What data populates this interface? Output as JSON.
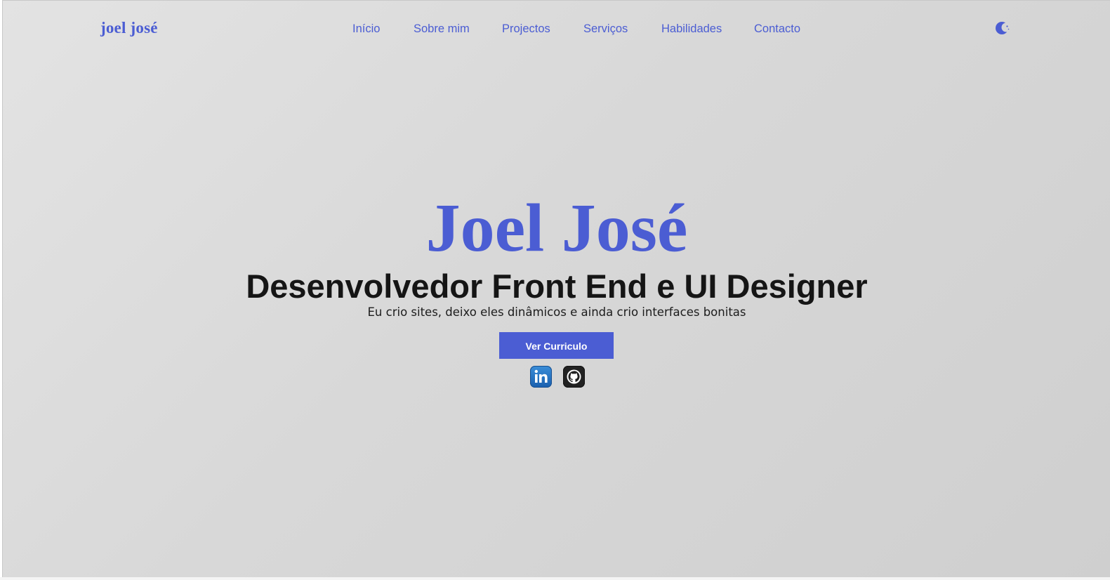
{
  "header": {
    "logo": "joel josé",
    "nav": [
      {
        "label": "Início"
      },
      {
        "label": "Sobre mim"
      },
      {
        "label": "Projectos"
      },
      {
        "label": "Serviços"
      },
      {
        "label": "Habilidades"
      },
      {
        "label": "Contacto"
      }
    ],
    "theme_toggle_icon": "moon-icon"
  },
  "hero": {
    "name": "Joel José",
    "role": "Desenvolvedor Front End e UI Designer",
    "tagline": "Eu crio sites, deixo eles dinâmicos e ainda crio interfaces bonitas",
    "cv_button_label": "Ver Curriculo",
    "social": [
      {
        "icon": "linkedin-icon"
      },
      {
        "icon": "github-icon"
      }
    ]
  },
  "colors": {
    "accent": "#4b5dd3",
    "text": "#151515",
    "background": "#d8d8d8"
  }
}
